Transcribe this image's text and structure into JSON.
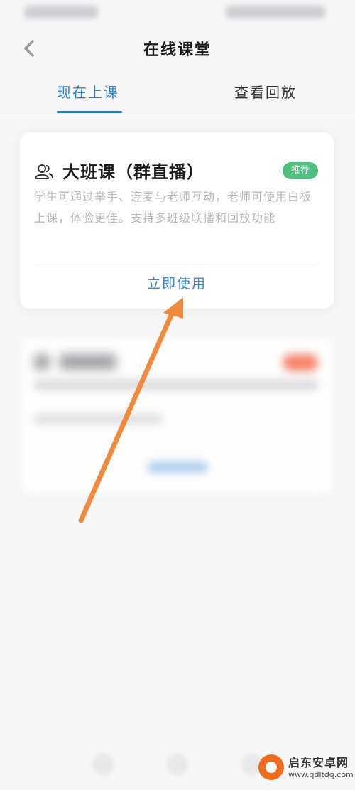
{
  "header": {
    "title": "在线课堂"
  },
  "tabs": [
    {
      "label": "现在上课",
      "active": true
    },
    {
      "label": "查看回放",
      "active": false
    }
  ],
  "cards": [
    {
      "title": "大班课（群直播）",
      "badge": "推荐",
      "description": "学生可通过举手、连麦与老师互动，老师可使用白板上课，体验更佳。支持多班级联播和回放功能",
      "action": "立即使用",
      "icon": "group-users-icon"
    }
  ],
  "annotation": {
    "arrow_color": "#f08a3c"
  },
  "watermark": {
    "name": "启东安卓网",
    "url": "www.qdltdq.com"
  },
  "colors": {
    "accent": "#2f7fd0",
    "badge_green": "#4fc07e",
    "badge_orange": "#f47a5c"
  }
}
